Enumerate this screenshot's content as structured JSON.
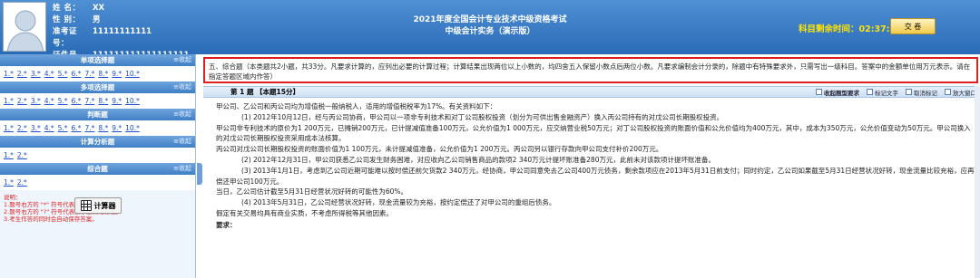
{
  "candidate": {
    "name_label": "姓  名：",
    "name_value": "XX",
    "gender_label": "性  别：",
    "gender_value": "男",
    "admission_label": "准考证号：",
    "admission_value": "11111111111",
    "id_label": "证件号码：",
    "id_value": "111111111111111111"
  },
  "exam": {
    "title": "2021年度全国会计专业技术中级资格考试",
    "subtitle": "中级会计实务（演示版）"
  },
  "timer": {
    "label": "科目剩余时间：",
    "value": "02:37:31"
  },
  "submit_label": "交 卷",
  "sidebar": {
    "collapse_label": "≡收起",
    "sections": [
      {
        "title": "单项选择题",
        "items": [
          "1.*",
          "2.*",
          "3.*",
          "4.*",
          "5.*",
          "6.*",
          "7.*",
          "8.*",
          "9.*",
          "10.*"
        ]
      },
      {
        "title": "多项选择题",
        "items": [
          "1.*",
          "2.*",
          "3.*",
          "4.*",
          "5.*",
          "6.*",
          "7.*",
          "8.*",
          "9.*",
          "10.*"
        ]
      },
      {
        "title": "判断题",
        "items": [
          "1.*",
          "2.*",
          "3.*",
          "4.*",
          "5.*",
          "6.*",
          "7.*",
          "8.*",
          "9.*",
          "10.*"
        ]
      },
      {
        "title": "计算分析题",
        "items": [
          "1.*",
          "2.*"
        ]
      },
      {
        "title": "综合题",
        "items": [
          "1.*",
          "2.*"
        ]
      }
    ],
    "notes": [
      "说明：",
      "1.题号右方的 \"*\" 符号代表该小题尚未作答。",
      "2.题号右方的 \"?\" 符号代表该小题做过标记。",
      "3.考生作答的同时会自动保存答案。"
    ],
    "calculator_label": "计算器"
  },
  "instruction": "五、综合题（本类题共2小题，共33分。凡要求计算的，应列出必要的计算过程；计算结果出现两位以上小数的，均四舍五入保留小数点后两位小数。凡要求编制会计分录的，除题中有特殊要求外，只需写出一级科目。答案中的金额单位用万元表示。请在指定答题区域内作答）",
  "question_bar": {
    "title": "第 1 题 【本题15分】",
    "tools": [
      "收起题型要求",
      "标记文字",
      "取消标记",
      "放大窗口"
    ]
  },
  "question": {
    "paragraphs": [
      "甲公司、乙公司和丙公司均为增值税一般纳税人，适用的增值税税率为17%。有关资料如下：",
      "(1) 2012年10月12日，经与丙公司协商，甲公司以一项非专利技术和对丁公司股权投资（划分为可供出售金融资产）换入丙公司持有的对戊公司长期股权投资。",
      "甲公司非专利技术的原价为1 200万元，已摊销200万元，已计提减值准备100万元，公允价值为1 000万元，应交纳营业税50万元；对丁公司股权投资的账面价值和公允价值均为400万元，其中，成本为350万元，公允价值变动为50万元。甲公司换入的对戊公司长期股权投资采用成本法核算。",
      "丙公司对戊公司长期股权投资的账面价值为1 100万元，未计提减值准备，公允价值为1 200万元。丙公司另以银行存款向甲公司支付补价200万元。",
      "(2) 2012年12月31日，甲公司获悉乙公司发生财务困难，对应收向乙公司销售商品的款项2 340万元计提坏账准备280万元，此前未对该款项计提坏账准备。",
      "(3) 2013年1月1日，考虑到乙公司近期可能难以按时偿还前欠货款2 340万元，经协商，甲公司同意免去乙公司400万元债务，剩余款项应在2013年5月31日前支付；同时约定，乙公司如果截至5月31日经营状况好转，现金流量比较充裕，应再偿还甲公司100万元。",
      "当日，乙公司估计截至5月31日经营状况好转的可能性为60%。",
      "(4) 2013年5月31日，乙公司经营状况好转，现金流量较为充裕，按约定偿还了对甲公司的重组后债务。",
      "假定有关交易均具有商业实质，不考虑所得税等其他因素。",
      "要求："
    ]
  }
}
